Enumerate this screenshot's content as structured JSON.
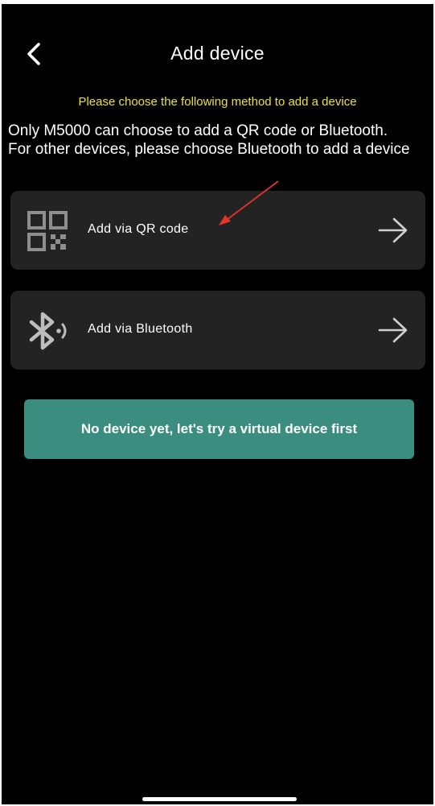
{
  "header": {
    "title": "Add device",
    "back_icon": "chevron-left-icon"
  },
  "hint": "Please choose the following method to add a device",
  "note": "Only M5000 can choose to add a QR code or Bluetooth. For other devices, please choose Bluetooth to add a device",
  "options": [
    {
      "label": "Add via QR code",
      "icon": "qr-code-icon",
      "arrow_icon": "arrow-right-icon"
    },
    {
      "label": "Add via Bluetooth",
      "icon": "bluetooth-icon",
      "arrow_icon": "arrow-right-icon"
    }
  ],
  "virtual_button": {
    "label": "No device yet, let's try a virtual device first"
  },
  "colors": {
    "background": "#000000",
    "card": "#232323",
    "hint_text": "#e9e13c",
    "accent_button": "#3b8d7f",
    "annotation_arrow": "#e5342c"
  }
}
